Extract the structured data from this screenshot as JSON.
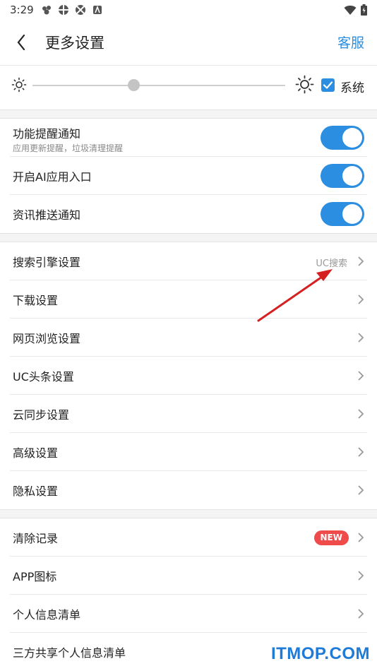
{
  "status_bar": {
    "time": "3:29"
  },
  "header": {
    "title": "更多设置",
    "service_label": "客服"
  },
  "brightness": {
    "level_fraction": 0.4,
    "system_checked": true,
    "system_label": "系统"
  },
  "notifications": [
    {
      "label": "功能提醒通知",
      "sub": "应用更新提醒，垃圾清理提醒",
      "on": true
    },
    {
      "label": "开启AI应用入口",
      "on": true
    },
    {
      "label": "资讯推送通知",
      "on": true
    }
  ],
  "settings": [
    {
      "label": "搜索引擎设置",
      "value": "UC搜索"
    },
    {
      "label": "下载设置"
    },
    {
      "label": "网页浏览设置"
    },
    {
      "label": "UC头条设置"
    },
    {
      "label": "云同步设置"
    },
    {
      "label": "高级设置"
    },
    {
      "label": "隐私设置"
    }
  ],
  "privacy": [
    {
      "label": "清除记录",
      "badge": "NEW"
    },
    {
      "label": "APP图标"
    },
    {
      "label": "个人信息清单"
    },
    {
      "label": "三方共享个人信息清单"
    }
  ],
  "watermark": "ITMOP.COM",
  "colors": {
    "accent": "#2b8ee0",
    "badge": "#ef4b4b",
    "annotation_arrow": "#d42020"
  }
}
